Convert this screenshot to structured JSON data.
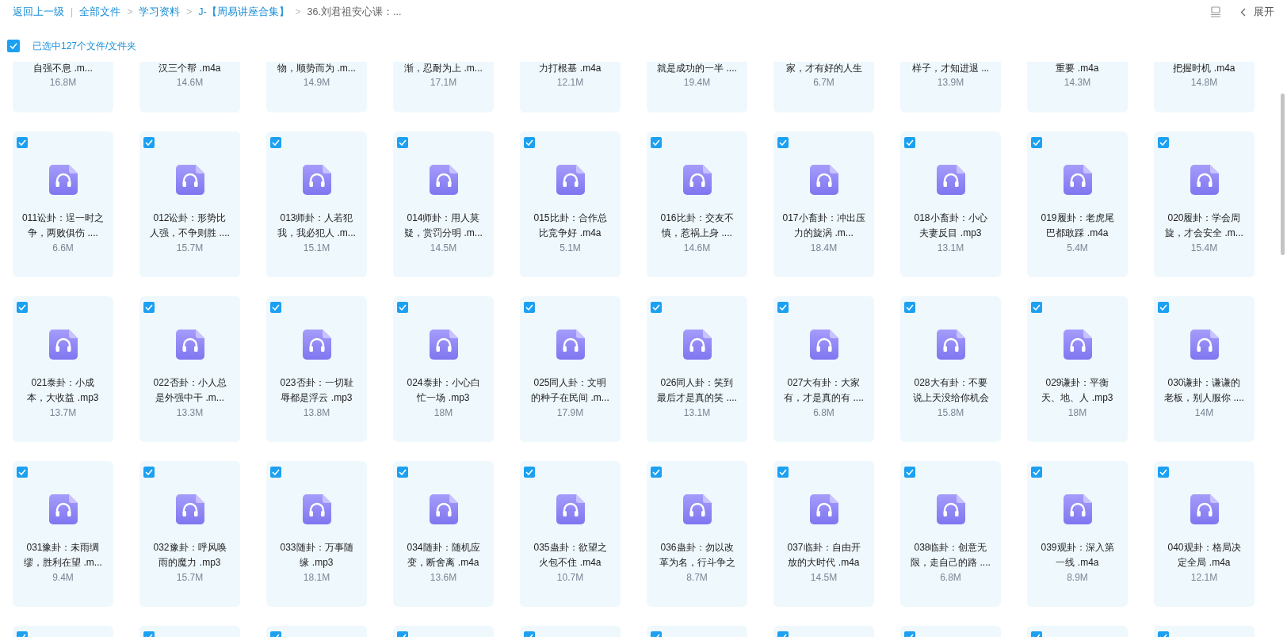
{
  "breadcrumb": [
    {
      "label": "返回上一级",
      "separator": "|"
    },
    {
      "label": "全部文件",
      "separator": ">"
    },
    {
      "label": "学习资料",
      "separator": ">"
    },
    {
      "label": "J-【周易讲座合集】",
      "separator": ">"
    },
    {
      "label": "36.刘君祖安心课：..."
    }
  ],
  "expand_button": {
    "label": "展开"
  },
  "selection": {
    "checked": true,
    "label": "已选中127个文件/文件夹"
  },
  "files": [
    {
      "kind": "partial",
      "name_lines": [
        "自强不息 .m..."
      ],
      "size": "16.8M"
    },
    {
      "kind": "partial",
      "name_lines": [
        "汉三个帮 .m4a"
      ],
      "size": "14.6M"
    },
    {
      "kind": "partial",
      "name_lines": [
        "物，顺势而为 .m..."
      ],
      "size": "14.9M"
    },
    {
      "kind": "partial",
      "name_lines": [
        "渐，忍耐为上 .m..."
      ],
      "size": "17.1M"
    },
    {
      "kind": "partial",
      "name_lines": [
        "力打根基 .m4a"
      ],
      "size": "12.1M"
    },
    {
      "kind": "partial",
      "name_lines": [
        "就是成功的一半 ...."
      ],
      "size": "19.4M"
    },
    {
      "kind": "partial",
      "name_lines": [
        "家，才有好的人生"
      ],
      "size": "6.7M"
    },
    {
      "kind": "partial",
      "name_lines": [
        "样子，才知进退 ..."
      ],
      "size": "13.9M"
    },
    {
      "kind": "partial",
      "name_lines": [
        "重要 .m4a"
      ],
      "size": "14.3M"
    },
    {
      "kind": "partial",
      "name_lines": [
        "把握时机 .m4a"
      ],
      "size": "14.8M"
    },
    {
      "kind": "audio",
      "checked": true,
      "name_lines": [
        "011讼卦：逞一时之",
        "争，两败俱伤 ...."
      ],
      "size": "6.6M"
    },
    {
      "kind": "audio",
      "checked": true,
      "name_lines": [
        "012讼卦：形势比",
        "人强，不争则胜 ...."
      ],
      "size": "15.7M"
    },
    {
      "kind": "audio",
      "checked": true,
      "name_lines": [
        "013师卦：人若犯",
        "我，我必犯人 .m..."
      ],
      "size": "15.1M"
    },
    {
      "kind": "audio",
      "checked": true,
      "name_lines": [
        "014师卦：用人莫",
        "疑，赏罚分明 .m..."
      ],
      "size": "14.5M"
    },
    {
      "kind": "audio",
      "checked": true,
      "name_lines": [
        "015比卦：合作总",
        "比竞争好 .m4a"
      ],
      "size": "5.1M"
    },
    {
      "kind": "audio",
      "checked": true,
      "name_lines": [
        "016比卦：交友不",
        "慎，惹祸上身 ...."
      ],
      "size": "14.6M"
    },
    {
      "kind": "audio",
      "checked": true,
      "name_lines": [
        "017小畜卦：冲出压",
        "力的旋涡 .m..."
      ],
      "size": "18.4M"
    },
    {
      "kind": "audio",
      "checked": true,
      "name_lines": [
        "018小畜卦：小心",
        "夫妻反目 .mp3"
      ],
      "size": "13.1M"
    },
    {
      "kind": "audio",
      "checked": true,
      "name_lines": [
        "019履卦：老虎尾",
        "巴都敢踩 .m4a"
      ],
      "size": "5.4M"
    },
    {
      "kind": "audio",
      "checked": true,
      "name_lines": [
        "020履卦：学会周",
        "旋，才会安全 .m..."
      ],
      "size": "15.4M"
    },
    {
      "kind": "audio",
      "checked": true,
      "name_lines": [
        "021泰卦：小成",
        "本，大收益 .mp3"
      ],
      "size": "13.7M"
    },
    {
      "kind": "audio",
      "checked": true,
      "name_lines": [
        "022否卦：小人总",
        "是外强中干 .m..."
      ],
      "size": "13.3M"
    },
    {
      "kind": "audio",
      "checked": true,
      "name_lines": [
        "023否卦：一切耻",
        "辱都是浮云 .mp3"
      ],
      "size": "13.8M"
    },
    {
      "kind": "audio",
      "checked": true,
      "name_lines": [
        "024泰卦：小心白",
        "忙一场 .mp3"
      ],
      "size": "18M"
    },
    {
      "kind": "audio",
      "checked": true,
      "name_lines": [
        "025同人卦：文明",
        "的种子在民间 .m..."
      ],
      "size": "17.9M"
    },
    {
      "kind": "audio",
      "checked": true,
      "name_lines": [
        "026同人卦：笑到",
        "最后才是真的笑 ...."
      ],
      "size": "13.1M"
    },
    {
      "kind": "audio",
      "checked": true,
      "name_lines": [
        "027大有卦：大家",
        "有，才是真的有 ...."
      ],
      "size": "6.8M"
    },
    {
      "kind": "audio",
      "checked": true,
      "name_lines": [
        "028大有卦：不要",
        "说上天没给你机会"
      ],
      "size": "15.8M"
    },
    {
      "kind": "audio",
      "checked": true,
      "name_lines": [
        "029谦卦：平衡",
        "天、地、人 .mp3"
      ],
      "size": "18M"
    },
    {
      "kind": "audio",
      "checked": true,
      "name_lines": [
        "030谦卦：谦谦的",
        "老板，别人服你 ...."
      ],
      "size": "14M"
    },
    {
      "kind": "audio",
      "checked": true,
      "name_lines": [
        "031豫卦：未雨绸",
        "缪，胜利在望 .m..."
      ],
      "size": "9.4M"
    },
    {
      "kind": "audio",
      "checked": true,
      "name_lines": [
        "032豫卦：呼风唤",
        "雨的魔力 .mp3"
      ],
      "size": "15.7M"
    },
    {
      "kind": "audio",
      "checked": true,
      "name_lines": [
        "033随卦：万事随",
        "缘 .mp3"
      ],
      "size": "18.1M"
    },
    {
      "kind": "audio",
      "checked": true,
      "name_lines": [
        "034随卦：随机应",
        "变，断舍离 .m4a"
      ],
      "size": "13.6M"
    },
    {
      "kind": "audio",
      "checked": true,
      "name_lines": [
        "035蛊卦：欲望之",
        "火包不住 .m4a"
      ],
      "size": "10.7M"
    },
    {
      "kind": "audio",
      "checked": true,
      "name_lines": [
        "036蛊卦：勿以改",
        "革为名，行斗争之"
      ],
      "size": "8.7M"
    },
    {
      "kind": "audio",
      "checked": true,
      "name_lines": [
        "037临卦：自由开",
        "放的大时代 .m4a"
      ],
      "size": "14.5M"
    },
    {
      "kind": "audio",
      "checked": true,
      "name_lines": [
        "038临卦：创意无",
        "限，走自己的路 ...."
      ],
      "size": "6.8M"
    },
    {
      "kind": "audio",
      "checked": true,
      "name_lines": [
        "039观卦：深入第",
        "一线 .m4a"
      ],
      "size": "8.9M"
    },
    {
      "kind": "audio",
      "checked": true,
      "name_lines": [
        "040观卦：格局决",
        "定全局 .m4a"
      ],
      "size": "12.1M"
    },
    {
      "kind": "audio",
      "checked": true
    },
    {
      "kind": "audio",
      "checked": true
    },
    {
      "kind": "audio",
      "checked": true
    },
    {
      "kind": "audio",
      "checked": true
    },
    {
      "kind": "audio",
      "checked": true
    },
    {
      "kind": "audio",
      "checked": true
    },
    {
      "kind": "audio",
      "checked": true
    },
    {
      "kind": "audio",
      "checked": true
    },
    {
      "kind": "audio",
      "checked": true
    },
    {
      "kind": "audio",
      "checked": true
    }
  ]
}
